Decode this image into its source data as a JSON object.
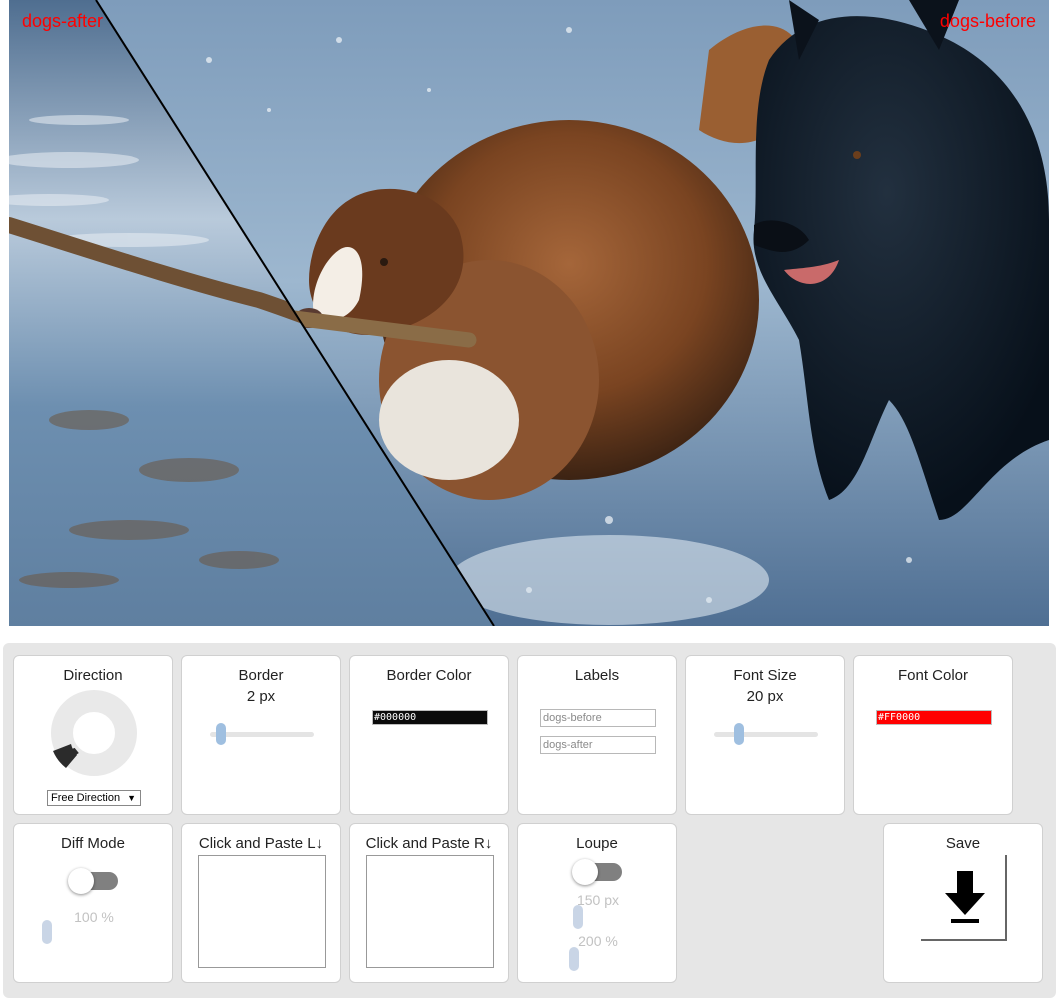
{
  "labels": {
    "left": "dogs-after",
    "right": "dogs-before"
  },
  "label_color": "#FF0000",
  "direction": {
    "title": "Direction",
    "select_value": "Free Direction",
    "select_arrow": "▼",
    "icon": "direction-dial-icon"
  },
  "border": {
    "title": "Border",
    "value": "2 px",
    "level": 0.1
  },
  "border_color": {
    "title": "Border Color",
    "value": "#000000",
    "swatch": "#000000"
  },
  "labels_card": {
    "title": "Labels",
    "before_value": "dogs-before",
    "after_value": "dogs-after"
  },
  "font_size": {
    "title": "Font Size",
    "value": "20 px",
    "level": 0.2
  },
  "font_color": {
    "title": "Font Color",
    "value": "#FF0000",
    "swatch": "#FF0000"
  },
  "diff_mode": {
    "title": "Diff Mode",
    "enabled": false,
    "percent": "100 %"
  },
  "paste_left": {
    "title": "Click and Paste L↓"
  },
  "paste_right": {
    "title": "Click and Paste R↓"
  },
  "loupe": {
    "title": "Loupe",
    "enabled": false,
    "size": "150 px",
    "zoom": "200 %"
  },
  "save": {
    "title": "Save",
    "icon": "download-icon"
  }
}
